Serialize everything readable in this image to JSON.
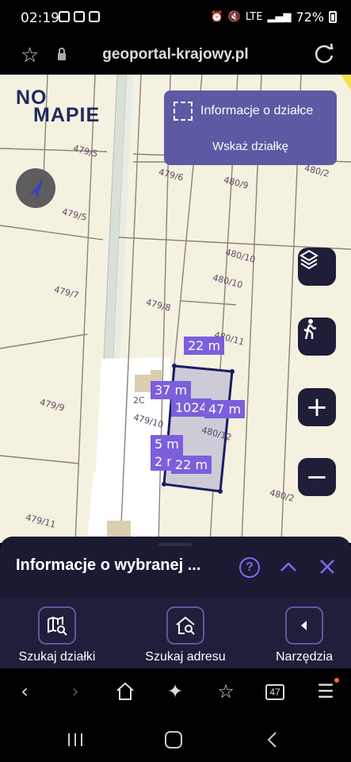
{
  "status_bar": {
    "time": "02:19",
    "battery": "72%",
    "network": "LTE"
  },
  "browser": {
    "url": "geoportal-krajowy.pl",
    "tabs_count": "47"
  },
  "map": {
    "logo_line1": "NO",
    "logo_line2": "MAPIE",
    "info_panel": {
      "title": "Informacje o działce",
      "action": "Wskaż działkę"
    },
    "parcel_labels": [
      "479/5",
      "479/6",
      "480/9",
      "480/2",
      "479/5",
      "480/10",
      "480/10",
      "479/7",
      "479/8",
      "480/11",
      "479/9",
      "479/10",
      "480/12",
      "480/2",
      "479/11",
      "2C"
    ],
    "measurements": {
      "top": "22 m",
      "left": "37 m",
      "right": "47 m",
      "area": "1024",
      "bottom": "22 m",
      "small1": "5 m",
      "small2": "2 m"
    }
  },
  "sheet": {
    "title": "Informacje o wybranej ...",
    "help": "?",
    "tools": [
      {
        "label": "Szukaj działki",
        "icon": "map-search-icon"
      },
      {
        "label": "Szukaj adresu",
        "icon": "home-search-icon"
      },
      {
        "label": "Narzędzia",
        "icon": "caret-left-icon"
      }
    ]
  },
  "colors": {
    "accent": "#5b5aa3",
    "measure": "#7b5fdc",
    "sheet": "#1a1b33",
    "map_bg": "#f4f1e0"
  }
}
